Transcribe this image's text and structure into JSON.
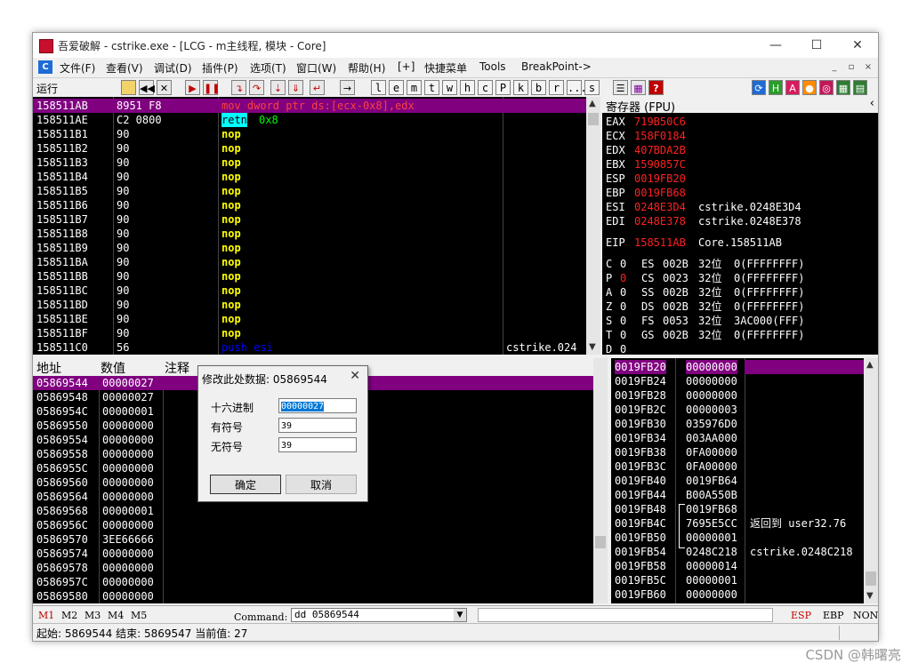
{
  "window": {
    "title": "吾爱破解 - cstrike.exe - [LCG - m主线程, 模块 - Core]",
    "min": "—",
    "max": "☐",
    "close": "✕"
  },
  "menu": {
    "items": [
      "文件(F)",
      "查看(V)",
      "调试(D)",
      "插件(P)",
      "选项(T)",
      "窗口(W)",
      "帮助(H)",
      "[+]",
      "快捷菜单",
      "Tools",
      "BreakPoint->"
    ],
    "mdi": [
      "_",
      "▫",
      "×"
    ]
  },
  "toolbar": {
    "status": "运行",
    "letters": [
      "l",
      "e",
      "m",
      "t",
      "w",
      "h",
      "c",
      "P",
      "k",
      "b",
      "r",
      "...",
      "s"
    ]
  },
  "disasm": {
    "rows": [
      {
        "addr": "158511AB",
        "hex": "8951 F8",
        "asm": "mov dword ptr ds:[ecx-0x8],edx",
        "cmt": ""
      },
      {
        "addr": "158511AE",
        "hex": "C2 0800",
        "asm": "retn",
        "arg": "0x8",
        "cmt": ""
      },
      {
        "addr": "158511B1",
        "hex": "90",
        "asm": "nop",
        "cmt": ""
      },
      {
        "addr": "158511B2",
        "hex": "90",
        "asm": "nop",
        "cmt": ""
      },
      {
        "addr": "158511B3",
        "hex": "90",
        "asm": "nop",
        "cmt": ""
      },
      {
        "addr": "158511B4",
        "hex": "90",
        "asm": "nop",
        "cmt": ""
      },
      {
        "addr": "158511B5",
        "hex": "90",
        "asm": "nop",
        "cmt": ""
      },
      {
        "addr": "158511B6",
        "hex": "90",
        "asm": "nop",
        "cmt": ""
      },
      {
        "addr": "158511B7",
        "hex": "90",
        "asm": "nop",
        "cmt": ""
      },
      {
        "addr": "158511B8",
        "hex": "90",
        "asm": "nop",
        "cmt": ""
      },
      {
        "addr": "158511B9",
        "hex": "90",
        "asm": "nop",
        "cmt": ""
      },
      {
        "addr": "158511BA",
        "hex": "90",
        "asm": "nop",
        "cmt": ""
      },
      {
        "addr": "158511BB",
        "hex": "90",
        "asm": "nop",
        "cmt": ""
      },
      {
        "addr": "158511BC",
        "hex": "90",
        "asm": "nop",
        "cmt": ""
      },
      {
        "addr": "158511BD",
        "hex": "90",
        "asm": "nop",
        "cmt": ""
      },
      {
        "addr": "158511BE",
        "hex": "90",
        "asm": "nop",
        "cmt": ""
      },
      {
        "addr": "158511BF",
        "hex": "90",
        "asm": "nop",
        "cmt": ""
      },
      {
        "addr": "158511C0",
        "hex": "56",
        "asm": "push esi",
        "cmt": "cstrike.024"
      }
    ]
  },
  "registers": {
    "header": "寄存器 (FPU)",
    "gp": [
      {
        "name": "EAX",
        "val": "719B50C6",
        "note": ""
      },
      {
        "name": "ECX",
        "val": "158F0184",
        "note": ""
      },
      {
        "name": "EDX",
        "val": "407BDA2B",
        "note": ""
      },
      {
        "name": "EBX",
        "val": "1590857C",
        "note": ""
      },
      {
        "name": "ESP",
        "val": "0019FB20",
        "note": ""
      },
      {
        "name": "EBP",
        "val": "0019FB68",
        "note": ""
      },
      {
        "name": "ESI",
        "val": "0248E3D4",
        "note": "cstrike.0248E3D4"
      },
      {
        "name": "EDI",
        "val": "0248E378",
        "note": "cstrike.0248E378"
      }
    ],
    "eip": {
      "name": "EIP",
      "val": "158511AB",
      "note": "Core.158511AB"
    },
    "flags": [
      {
        "f": "C",
        "v": "0",
        "seg": "ES",
        "sel": "002B",
        "bits": "32位",
        "desc": "0(FFFFFFFF)"
      },
      {
        "f": "P",
        "v": "0",
        "seg": "CS",
        "sel": "0023",
        "bits": "32位",
        "desc": "0(FFFFFFFF)"
      },
      {
        "f": "A",
        "v": "0",
        "seg": "SS",
        "sel": "002B",
        "bits": "32位",
        "desc": "0(FFFFFFFF)"
      },
      {
        "f": "Z",
        "v": "0",
        "seg": "DS",
        "sel": "002B",
        "bits": "32位",
        "desc": "0(FFFFFFFF)"
      },
      {
        "f": "S",
        "v": "0",
        "seg": "FS",
        "sel": "0053",
        "bits": "32位",
        "desc": "3AC000(FFF)"
      },
      {
        "f": "T",
        "v": "0",
        "seg": "GS",
        "sel": "002B",
        "bits": "32位",
        "desc": "0(FFFFFFFF)"
      },
      {
        "f": "D",
        "v": "0",
        "seg": "",
        "sel": "",
        "bits": "",
        "desc": ""
      }
    ]
  },
  "dump": {
    "col_addr": "地址",
    "col_val": "数值",
    "col_cmt": "注释",
    "rows": [
      {
        "addr": "05869544",
        "val": "00000027"
      },
      {
        "addr": "05869548",
        "val": "00000027"
      },
      {
        "addr": "0586954C",
        "val": "00000001"
      },
      {
        "addr": "05869550",
        "val": "00000000"
      },
      {
        "addr": "05869554",
        "val": "00000000"
      },
      {
        "addr": "05869558",
        "val": "00000000"
      },
      {
        "addr": "0586955C",
        "val": "00000000"
      },
      {
        "addr": "05869560",
        "val": "00000000"
      },
      {
        "addr": "05869564",
        "val": "00000000"
      },
      {
        "addr": "05869568",
        "val": "00000001"
      },
      {
        "addr": "0586956C",
        "val": "00000000"
      },
      {
        "addr": "05869570",
        "val": "3EE66666"
      },
      {
        "addr": "05869574",
        "val": "00000000"
      },
      {
        "addr": "05869578",
        "val": "00000000"
      },
      {
        "addr": "0586957C",
        "val": "00000000"
      },
      {
        "addr": "05869580",
        "val": "00000000"
      }
    ]
  },
  "stack": {
    "rows": [
      {
        "addr": "0019FB20",
        "val": "00000000",
        "cmt": ""
      },
      {
        "addr": "0019FB24",
        "val": "00000000",
        "cmt": ""
      },
      {
        "addr": "0019FB28",
        "val": "00000000",
        "cmt": ""
      },
      {
        "addr": "0019FB2C",
        "val": "00000003",
        "cmt": ""
      },
      {
        "addr": "0019FB30",
        "val": "035976D0",
        "cmt": ""
      },
      {
        "addr": "0019FB34",
        "val": "003AA000",
        "cmt": ""
      },
      {
        "addr": "0019FB38",
        "val": "0FA00000",
        "cmt": ""
      },
      {
        "addr": "0019FB3C",
        "val": "0FA00000",
        "cmt": ""
      },
      {
        "addr": "0019FB40",
        "val": "0019FB64",
        "cmt": ""
      },
      {
        "addr": "0019FB44",
        "val": "B00A550B",
        "cmt": ""
      },
      {
        "addr": "0019FB48",
        "val": "0019FB68",
        "cmt": ""
      },
      {
        "addr": "0019FB4C",
        "val": "7695E5CC",
        "cmt": "返回到 user32.76"
      },
      {
        "addr": "0019FB50",
        "val": "00000001",
        "cmt": ""
      },
      {
        "addr": "0019FB54",
        "val": "0248C218",
        "cmt": "cstrike.0248C218"
      },
      {
        "addr": "0019FB58",
        "val": "00000014",
        "cmt": ""
      },
      {
        "addr": "0019FB5C",
        "val": "00000001",
        "cmt": ""
      },
      {
        "addr": "0019FB60",
        "val": "00000000",
        "cmt": ""
      }
    ]
  },
  "dialog": {
    "title": "修改此处数据:  05869544",
    "close": "✕",
    "hex_label": "十六进制",
    "hex_value": "00000027",
    "signed_label": "有符号",
    "signed_value": "39",
    "unsigned_label": "无符号",
    "unsigned_value": "39",
    "ok": "确定",
    "cancel": "取消"
  },
  "cmdbar": {
    "tabs": [
      "M1",
      "M2",
      "M3",
      "M4",
      "M5"
    ],
    "command_label": "Command:",
    "command_value": "dd 05869544",
    "right": [
      "ESP",
      "EBP",
      "NONE"
    ]
  },
  "status": {
    "text": "起始: 5869544 结束: 5869547 当前值: 27"
  },
  "watermark": "CSDN @韩曙亮",
  "colors": {
    "selection": "#800080",
    "nop": "#ffff00",
    "reg_value": "#ff2020",
    "retn_bg": "#00ffff"
  }
}
